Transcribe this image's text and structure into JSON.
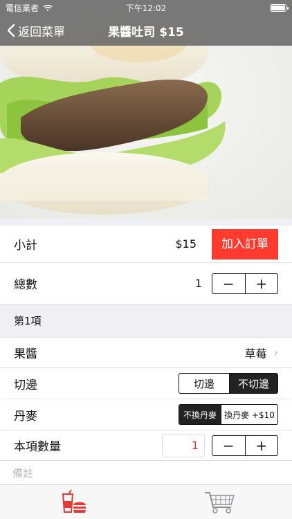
{
  "status": {
    "carrier": "電信業者",
    "time": "下午12:02"
  },
  "nav": {
    "back_label": "返回菜單",
    "title": "果醬吐司 $15"
  },
  "summary": {
    "subtotal_label": "小計",
    "subtotal_value": "$15",
    "add_order_label": "加入訂單",
    "total_label": "總數",
    "total_value": "1",
    "minus": "−",
    "plus": "+"
  },
  "item": {
    "header": "第1項",
    "jam_label": "果醬",
    "jam_value": "草莓",
    "crust_label": "切邊",
    "crust_options": [
      "切邊",
      "不切邊"
    ],
    "crust_selected": 1,
    "danmai_label": "丹麥",
    "danmai_options": [
      "不換丹麥",
      "換丹麥 +$10"
    ],
    "danmai_selected": 0,
    "qty_label": "本項數量",
    "qty_value": "1",
    "note_placeholder": "備註"
  },
  "colors": {
    "accent": "#ff3b30",
    "nav_overlay": "#6e6e6e",
    "qty_text": "#e03a2e"
  },
  "tabs": [
    {
      "icon": "menu-drink-burger-icon",
      "active": true
    },
    {
      "icon": "shopping-cart-icon",
      "active": false
    }
  ]
}
